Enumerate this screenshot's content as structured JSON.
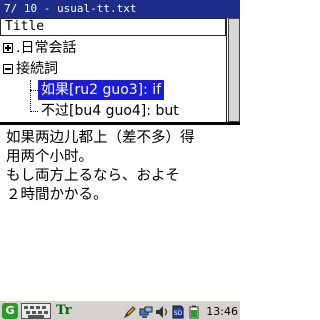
{
  "window": {
    "title": " 7/ 10 - usual-tt.txt"
  },
  "tree": {
    "header": "Title",
    "items": [
      {
        "label": ".日常会話",
        "expanded": false,
        "level": 0
      },
      {
        "label": "接続詞",
        "expanded": true,
        "level": 0
      },
      {
        "label": "如果[ru2 guo3]: if",
        "level": 1,
        "selected": true
      },
      {
        "label": "不过[bu4 guo4]: but",
        "level": 1,
        "selected": false
      }
    ]
  },
  "content": {
    "lines": [
      "如果两边儿都上（差不多）得",
      "用两个小时。",
      "もし両方上るなら、およそ",
      "２時間かかる。"
    ]
  },
  "taskbar": {
    "start_icon": "G",
    "input_method_icon": "Tr",
    "clock": "13:46"
  },
  "colors": {
    "titlebar_bg": "#1c2c88",
    "selection_bg": "#1c1cd8",
    "taskbar_bg": "#d6d3ce"
  }
}
